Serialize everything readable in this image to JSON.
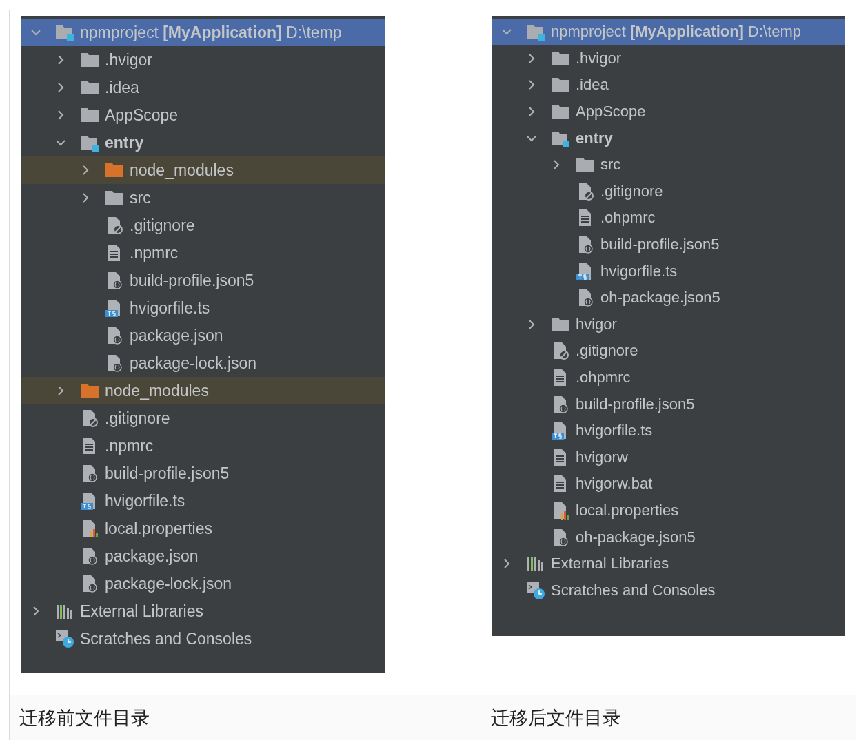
{
  "comparison_table": {
    "cells": [
      {
        "tree": [
          {
            "label": "npmproject **[MyApplication]** D:\\temp",
            "kind": "module",
            "expanded": true,
            "selected": true,
            "highlighted": false,
            "children": [
              {
                "label": ".hvigor",
                "kind": "folder",
                "expanded": false,
                "selected": false,
                "highlighted": false
              },
              {
                "label": ".idea",
                "kind": "folder",
                "expanded": false,
                "selected": false,
                "highlighted": false
              },
              {
                "label": "AppScope",
                "kind": "folder",
                "expanded": false,
                "selected": false,
                "highlighted": false
              },
              {
                "label": "entry",
                "kind": "module",
                "bold": true,
                "expanded": true,
                "selected": false,
                "highlighted": false,
                "children": [
                  {
                    "label": "node_modules",
                    "kind": "excluded",
                    "expanded": false,
                    "selected": false,
                    "highlighted": true
                  },
                  {
                    "label": "src",
                    "kind": "folder",
                    "expanded": false,
                    "selected": false,
                    "highlighted": false
                  },
                  {
                    "label": ".gitignore",
                    "kind": "ignore",
                    "selected": false,
                    "highlighted": false
                  },
                  {
                    "label": ".npmrc",
                    "kind": "text",
                    "selected": false,
                    "highlighted": false
                  },
                  {
                    "label": "build-profile.json5",
                    "kind": "json",
                    "selected": false,
                    "highlighted": false
                  },
                  {
                    "label": "hvigorfile.ts",
                    "kind": "ts",
                    "selected": false,
                    "highlighted": false
                  },
                  {
                    "label": "package.json",
                    "kind": "json",
                    "selected": false,
                    "highlighted": false
                  },
                  {
                    "label": "package-lock.json",
                    "kind": "json",
                    "selected": false,
                    "highlighted": false
                  }
                ]
              },
              {
                "label": "node_modules",
                "kind": "excluded",
                "expanded": false,
                "selected": false,
                "highlighted": true
              },
              {
                "label": ".gitignore",
                "kind": "ignore",
                "selected": false,
                "highlighted": false
              },
              {
                "label": ".npmrc",
                "kind": "text",
                "selected": false,
                "highlighted": false
              },
              {
                "label": "build-profile.json5",
                "kind": "json",
                "selected": false,
                "highlighted": false
              },
              {
                "label": "hvigorfile.ts",
                "kind": "ts",
                "selected": false,
                "highlighted": false
              },
              {
                "label": "local.properties",
                "kind": "properties",
                "selected": false,
                "highlighted": false
              },
              {
                "label": "package.json",
                "kind": "json",
                "selected": false,
                "highlighted": false
              },
              {
                "label": "package-lock.json",
                "kind": "json",
                "selected": false,
                "highlighted": false
              }
            ]
          },
          {
            "label": "External Libraries",
            "kind": "libraries",
            "expanded": false,
            "selected": false,
            "highlighted": false
          },
          {
            "label": "Scratches and Consoles",
            "kind": "scratches",
            "selected": false,
            "highlighted": false
          }
        ],
        "caption": "迁移前文件目录"
      },
      {
        "tree": [
          {
            "label": "npmproject **[MyApplication]** D:\\temp",
            "kind": "module",
            "expanded": true,
            "selected": true,
            "highlighted": false,
            "children": [
              {
                "label": ".hvigor",
                "kind": "folder",
                "expanded": false,
                "selected": false,
                "highlighted": false
              },
              {
                "label": ".idea",
                "kind": "folder",
                "expanded": false,
                "selected": false,
                "highlighted": false
              },
              {
                "label": "AppScope",
                "kind": "folder",
                "expanded": false,
                "selected": false,
                "highlighted": false
              },
              {
                "label": "entry",
                "kind": "module",
                "bold": true,
                "expanded": true,
                "selected": false,
                "highlighted": false,
                "children": [
                  {
                    "label": "src",
                    "kind": "folder",
                    "expanded": false,
                    "selected": false,
                    "highlighted": false
                  },
                  {
                    "label": ".gitignore",
                    "kind": "ignore",
                    "selected": false,
                    "highlighted": false
                  },
                  {
                    "label": ".ohpmrc",
                    "kind": "text",
                    "selected": false,
                    "highlighted": false
                  },
                  {
                    "label": "build-profile.json5",
                    "kind": "json",
                    "selected": false,
                    "highlighted": false
                  },
                  {
                    "label": "hvigorfile.ts",
                    "kind": "ts",
                    "selected": false,
                    "highlighted": false
                  },
                  {
                    "label": "oh-package.json5",
                    "kind": "json",
                    "selected": false,
                    "highlighted": false
                  }
                ]
              },
              {
                "label": "hvigor",
                "kind": "folder",
                "expanded": false,
                "selected": false,
                "highlighted": false
              },
              {
                "label": ".gitignore",
                "kind": "ignore",
                "selected": false,
                "highlighted": false
              },
              {
                "label": ".ohpmrc",
                "kind": "text",
                "selected": false,
                "highlighted": false
              },
              {
                "label": "build-profile.json5",
                "kind": "json",
                "selected": false,
                "highlighted": false
              },
              {
                "label": "hvigorfile.ts",
                "kind": "ts",
                "selected": false,
                "highlighted": false
              },
              {
                "label": "hvigorw",
                "kind": "text",
                "selected": false,
                "highlighted": false
              },
              {
                "label": "hvigorw.bat",
                "kind": "text",
                "selected": false,
                "highlighted": false
              },
              {
                "label": "local.properties",
                "kind": "properties",
                "selected": false,
                "highlighted": false
              },
              {
                "label": "oh-package.json5",
                "kind": "json",
                "selected": false,
                "highlighted": false
              }
            ]
          },
          {
            "label": "External Libraries",
            "kind": "libraries",
            "expanded": false,
            "selected": false,
            "highlighted": false
          },
          {
            "label": "Scratches and Consoles",
            "kind": "scratches",
            "selected": false,
            "highlighted": false
          }
        ],
        "caption": "迁移后文件目录"
      }
    ]
  }
}
